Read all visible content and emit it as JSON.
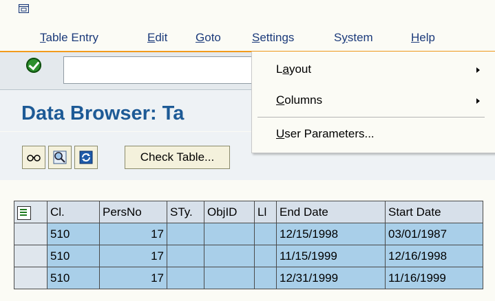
{
  "menubar": {
    "items": [
      {
        "label": "Table Entry",
        "mnemonic_index": 0
      },
      {
        "label": "Edit",
        "mnemonic_index": 0
      },
      {
        "label": "Goto",
        "mnemonic_index": 0
      },
      {
        "label": "Settings",
        "mnemonic_index": 0
      },
      {
        "label": "System",
        "mnemonic_index": 1
      },
      {
        "label": "Help",
        "mnemonic_index": 0
      }
    ]
  },
  "toolbar": {
    "command_value": ""
  },
  "page": {
    "title": "Data Browser: Ta"
  },
  "app_toolbar": {
    "check_table_label": "Check Table..."
  },
  "settings_menu": {
    "items": [
      {
        "label": "Layout",
        "mnemonic_index": 1,
        "submenu": true
      },
      {
        "label": "Columns",
        "mnemonic_index": 0,
        "submenu": true
      },
      {
        "label": "User Parameters...",
        "mnemonic_index": 0,
        "submenu": false
      }
    ]
  },
  "table": {
    "columns": [
      "Cl.",
      "PersNo",
      "STy.",
      "ObjID",
      "Ll",
      "End Date",
      "Start Date"
    ],
    "rows": [
      [
        "510",
        "17",
        "",
        "",
        "",
        "12/15/1998",
        "03/01/1987"
      ],
      [
        "510",
        "17",
        "",
        "",
        "",
        "11/15/1999",
        "12/16/1998"
      ],
      [
        "510",
        "17",
        "",
        "",
        "",
        "12/31/1999",
        "11/16/1999"
      ]
    ]
  },
  "colors": {
    "accent": "#f29b1c",
    "title": "#1d5a96",
    "menu_text": "#1b3a7a",
    "cell_fill": "#a9cfe9"
  }
}
